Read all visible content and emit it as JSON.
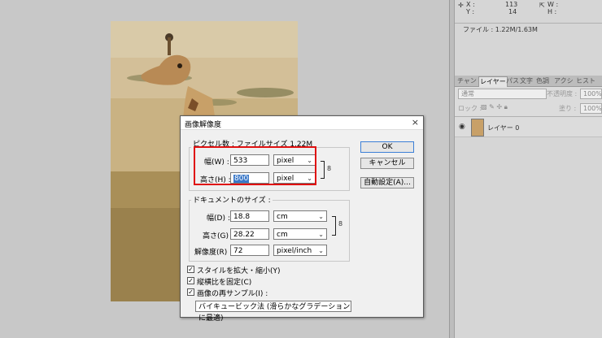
{
  "info_panel": {
    "x_label": "X :",
    "y_label": "Y :",
    "x_value": "113",
    "y_value": "14",
    "w_label": "W :",
    "h_label": "H :",
    "file_size": "ファイル : 1.22M/1.63M"
  },
  "layers_panel": {
    "tabs": [
      "チャン",
      "レイヤー",
      "パス",
      "文字",
      "色調",
      "アクシ",
      "ヒスト"
    ],
    "active_tab_index": 1,
    "blend_mode": "通常",
    "opacity_label": "不透明度 :",
    "opacity_value": "100%",
    "lock_label": "ロック :",
    "fill_label": "塗り :",
    "fill_value": "100%",
    "layer_name": "レイヤー 0"
  },
  "dialog": {
    "title": "画像解像度",
    "close_glyph": "×",
    "pixel_group_label": "ピクセル数 : ファイルサイズ 1.22M",
    "width_label": "幅(W) :",
    "width_value": "533",
    "width_unit": "pixel",
    "height_label": "高さ(H) :",
    "height_value": "800",
    "height_unit": "pixel",
    "doc_group_label": "ドキュメントのサイズ :",
    "doc_width_label": "幅(D) :",
    "doc_width_value": "18.8",
    "doc_width_unit": "cm",
    "doc_height_label": "高さ(G) :",
    "doc_height_value": "28.22",
    "doc_height_unit": "cm",
    "resolution_label": "解像度(R) :",
    "resolution_value": "72",
    "resolution_unit": "pixel/inch",
    "scale_styles_label": "スタイルを拡大・縮小(Y)",
    "constrain_label": "縦横比を固定(C)",
    "resample_label": "画像の再サンプル(I) :",
    "resample_method": "バイキュービック法 (滑らかなグラデーションに最適)",
    "ok_label": "OK",
    "cancel_label": "キャンセル",
    "auto_label": "自動設定(A)...",
    "check_glyph": "✓",
    "arrow_glyph": "⌄",
    "link_glyph": "8"
  }
}
